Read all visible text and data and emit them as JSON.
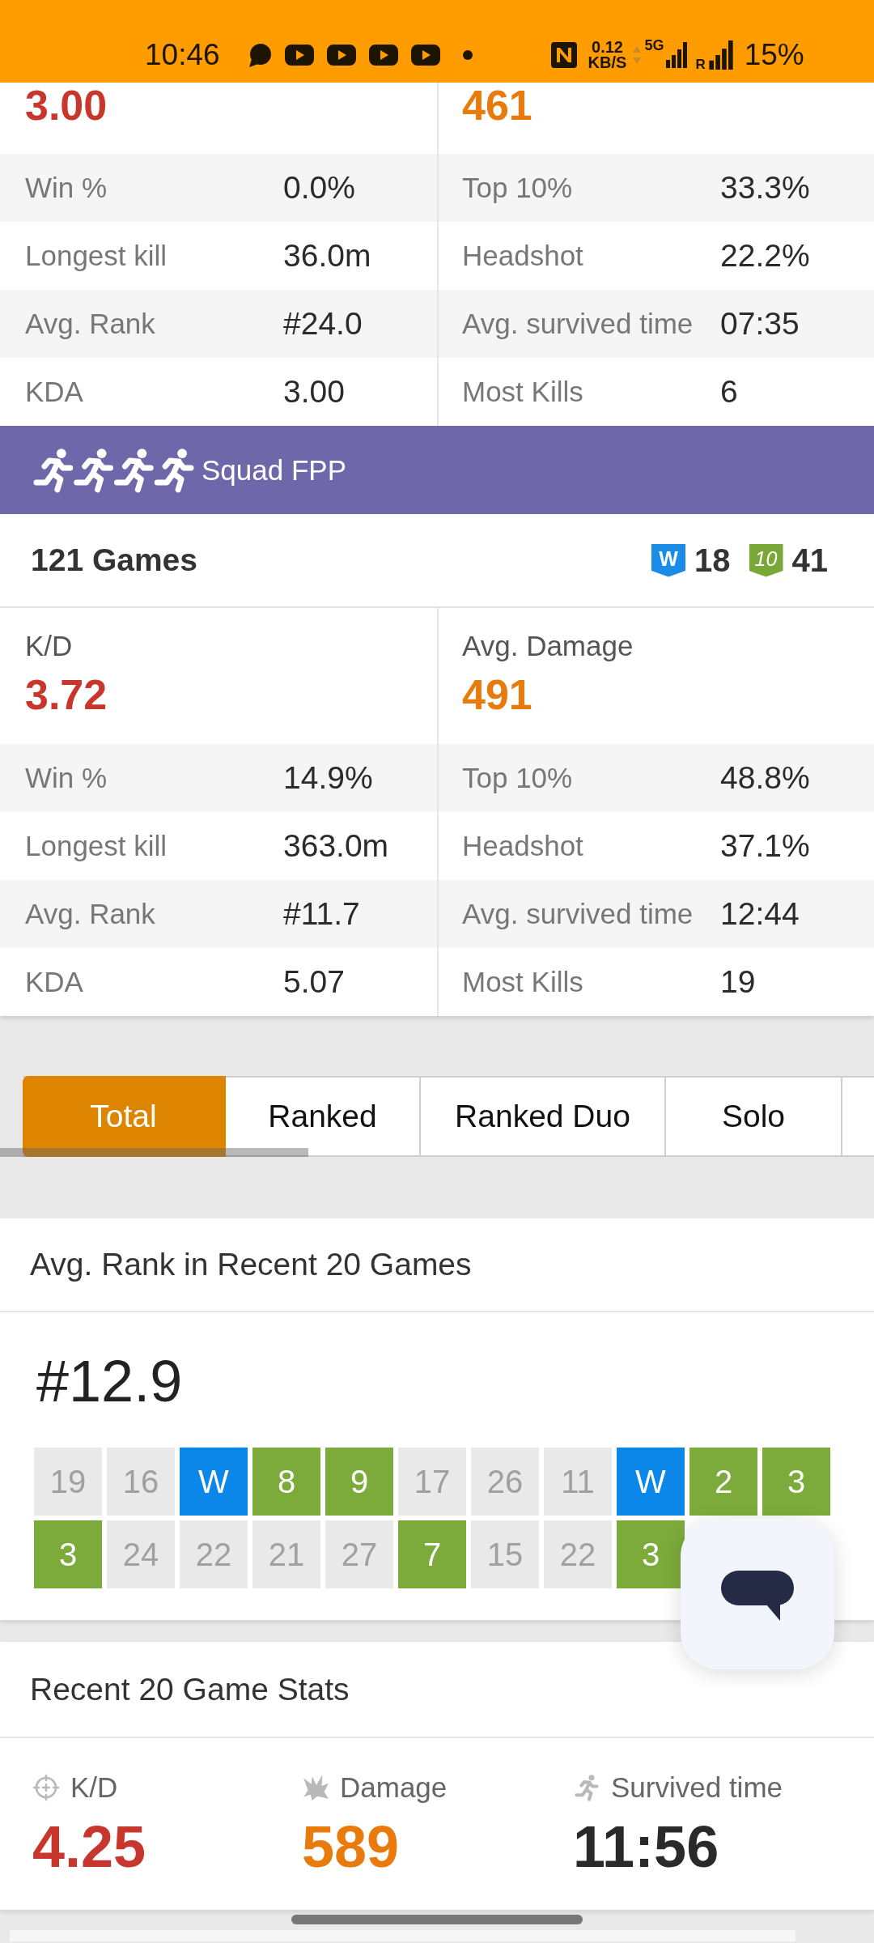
{
  "status_bar": {
    "time": "10:46",
    "net_speed": "0.12",
    "net_unit": "KB/S",
    "network_type": "5G",
    "signal_2_label": "R",
    "battery": "15%"
  },
  "top_stats": {
    "highlights": [
      {
        "kind": "kd",
        "value": "3.00"
      },
      {
        "kind": "damage",
        "value": "461"
      }
    ],
    "rows": [
      {
        "left": {
          "label": "Win %",
          "value": "0.0%"
        },
        "right": {
          "label": "Top 10%",
          "value": "33.3%"
        }
      },
      {
        "left": {
          "label": "Longest kill",
          "value": "36.0m"
        },
        "right": {
          "label": "Headshot",
          "value": "22.2%"
        }
      },
      {
        "left": {
          "label": "Avg. Rank",
          "value": "#24.0"
        },
        "right": {
          "label": "Avg. survived time",
          "value": "07:35"
        }
      },
      {
        "left": {
          "label": "KDA",
          "value": "3.00"
        },
        "right": {
          "label": "Most Kills",
          "value": "6"
        }
      }
    ]
  },
  "squad_fpp": {
    "title": "Squad FPP",
    "games": "121 Games",
    "badges": [
      {
        "kind": "win",
        "label": "W",
        "count": "18"
      },
      {
        "kind": "top10",
        "label": "10",
        "count": "41"
      }
    ],
    "highlights": [
      {
        "kind": "kd",
        "label": "K/D",
        "value": "3.72"
      },
      {
        "kind": "damage",
        "label": "Avg. Damage",
        "value": "491"
      }
    ],
    "rows": [
      {
        "left": {
          "label": "Win %",
          "value": "14.9%"
        },
        "right": {
          "label": "Top 10%",
          "value": "48.8%"
        }
      },
      {
        "left": {
          "label": "Longest kill",
          "value": "363.0m"
        },
        "right": {
          "label": "Headshot",
          "value": "37.1%"
        }
      },
      {
        "left": {
          "label": "Avg. Rank",
          "value": "#11.7"
        },
        "right": {
          "label": "Avg. survived time",
          "value": "12:44"
        }
      },
      {
        "left": {
          "label": "KDA",
          "value": "5.07"
        },
        "right": {
          "label": "Most Kills",
          "value": "19"
        }
      }
    ]
  },
  "tabs": [
    {
      "label": "Total",
      "selected": true
    },
    {
      "label": "Ranked",
      "selected": false
    },
    {
      "label": "Ranked Duo",
      "selected": false
    },
    {
      "label": "Solo",
      "selected": false
    }
  ],
  "recent_rank": {
    "title": "Avg. Rank in Recent 20 Games",
    "average": "#12.9",
    "games": [
      {
        "kind": "other",
        "rank": "19"
      },
      {
        "kind": "other",
        "rank": "16"
      },
      {
        "kind": "win",
        "rank": "W"
      },
      {
        "kind": "top10",
        "rank": "8"
      },
      {
        "kind": "top10",
        "rank": "9"
      },
      {
        "kind": "other",
        "rank": "17"
      },
      {
        "kind": "other",
        "rank": "26"
      },
      {
        "kind": "other",
        "rank": "11"
      },
      {
        "kind": "win",
        "rank": "W"
      },
      {
        "kind": "top10",
        "rank": "2"
      },
      {
        "kind": "top10",
        "rank": "3"
      },
      {
        "kind": "top10",
        "rank": "3"
      },
      {
        "kind": "other",
        "rank": "24"
      },
      {
        "kind": "other",
        "rank": "22"
      },
      {
        "kind": "other",
        "rank": "21"
      },
      {
        "kind": "other",
        "rank": "27"
      },
      {
        "kind": "top10",
        "rank": "7"
      },
      {
        "kind": "other",
        "rank": "15"
      },
      {
        "kind": "other",
        "rank": "22"
      },
      {
        "kind": "top10",
        "rank": "3"
      }
    ]
  },
  "recent_stats": {
    "title": "Recent 20 Game Stats",
    "items": [
      {
        "kind": "kd",
        "label": "K/D",
        "value": "4.25"
      },
      {
        "kind": "damage",
        "label": "Damage",
        "value": "589"
      },
      {
        "kind": "survived",
        "label": "Survived time",
        "value": "11:56"
      }
    ]
  }
}
